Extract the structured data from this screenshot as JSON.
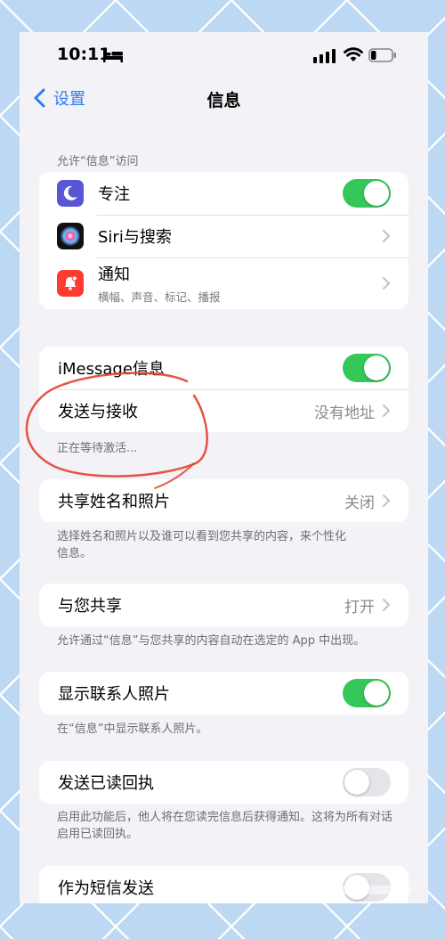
{
  "status_bar": {
    "time": "10:11",
    "icons": [
      "bed-icon",
      "cellular-signal-icon",
      "wifi-icon",
      "battery-icon"
    ],
    "battery_level": 0.25
  },
  "nav": {
    "back_label": "设置",
    "title": "信息"
  },
  "section_allow": {
    "header": "允许“信息”访问",
    "items": [
      {
        "icon": "moon-icon",
        "icon_color": "#5856d6",
        "label": "专注",
        "control": "toggle",
        "on": true
      },
      {
        "icon": "siri-icon",
        "icon_color": "#111111",
        "label": "Siri与搜索",
        "control": "chevron"
      },
      {
        "icon": "notification-bell-icon",
        "icon_color": "#ff3b30",
        "label": "通知",
        "sublabel": "横幅、声音、标记、播报",
        "control": "chevron"
      }
    ]
  },
  "section_imessage": {
    "items": [
      {
        "label": "iMessage信息",
        "control": "toggle",
        "on": true
      },
      {
        "label": "发送与接收",
        "value": "没有地址",
        "control": "chevron"
      }
    ],
    "footer": "正在等待激活..."
  },
  "section_share_name": {
    "label": "共享姓名和照片",
    "value": "关闭",
    "footer": "选择姓名和照片以及谁可以看到您共享的内容，来个性化信息。"
  },
  "section_shared_with_you": {
    "label": "与您共享",
    "value": "打开",
    "footer": "允许通过“信息”与您共享的内容自动在选定的 App 中出现。"
  },
  "section_contact_photos": {
    "label": "显示联系人照片",
    "on": true,
    "footer": "在“信息”中显示联系人照片。"
  },
  "section_read_receipts": {
    "label": "发送已读回执",
    "on": false,
    "footer": "启用此功能后，他人将在您读完信息后获得通知。这将为所有对话启用已读回执。"
  },
  "section_sms": {
    "label": "作为短信发送",
    "on": false
  },
  "colors": {
    "accent": "#2f7cf6",
    "toggle_on": "#34c759",
    "toggle_off": "#e4e4e9",
    "annotation": "#e0442c",
    "background": "#bcd8f2"
  }
}
